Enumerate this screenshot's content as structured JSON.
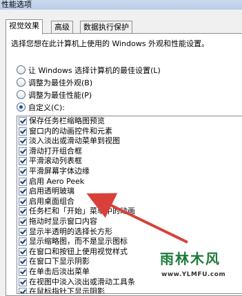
{
  "window": {
    "title": "性能选项"
  },
  "tabs": [
    {
      "label": "视觉效果",
      "active": true
    },
    {
      "label": "高级",
      "active": false
    },
    {
      "label": "数据执行保护",
      "active": false
    }
  ],
  "intro": "选择您想在此计算机上使用的 Windows 外观和性能设置。",
  "radios": [
    {
      "label": "让 Windows 选择计算机的最佳设置(L)",
      "checked": false
    },
    {
      "label": "调整为最佳外观(B)",
      "checked": false
    },
    {
      "label": "调整为最佳性能(P)",
      "checked": false
    },
    {
      "label": "自定义(C):",
      "checked": true
    }
  ],
  "effects": [
    {
      "label": "保存任务栏缩略图预览",
      "checked": true
    },
    {
      "label": "窗口内的动画控件和元素",
      "checked": true
    },
    {
      "label": "淡入淡出或滑动菜单到视图",
      "checked": true
    },
    {
      "label": "滑动打开组合框",
      "checked": true
    },
    {
      "label": "平滑滚动列表框",
      "checked": true
    },
    {
      "label": "平滑屏幕字体边缘",
      "checked": true
    },
    {
      "label": "启用 Aero Peek",
      "checked": true
    },
    {
      "label": "启用透明玻璃",
      "checked": true
    },
    {
      "label": "启用桌面组合",
      "checked": true
    },
    {
      "label": "任务栏和「开始」菜单中的动画",
      "checked": true
    },
    {
      "label": "拖动时显示窗口内容",
      "checked": true
    },
    {
      "label": "显示半透明的选择长方形",
      "checked": true
    },
    {
      "label": "显示缩略图，而不是显示图标",
      "checked": true
    },
    {
      "label": "在窗口和按钮上使用视觉样式",
      "checked": true
    },
    {
      "label": "在窗口下显示阴影",
      "checked": true
    },
    {
      "label": "在单击后淡出菜单",
      "checked": true
    },
    {
      "label": "在视图中淡入淡出或滑动工具条",
      "checked": true
    },
    {
      "label": "在鼠标指针下显示阴影",
      "checked": true
    }
  ],
  "watermark": {
    "name": "雨林木风",
    "url": "www.YLMFU.com"
  },
  "colors": {
    "arrow": "#d9403a",
    "accent": "#1d4f9a"
  }
}
